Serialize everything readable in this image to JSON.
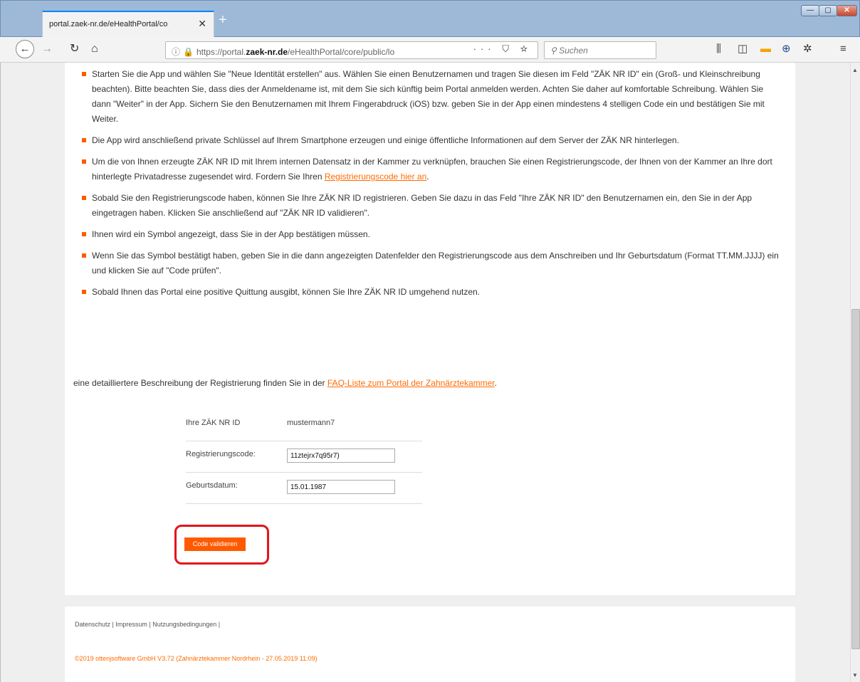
{
  "browser": {
    "tab_title": "portal.zaek-nr.de/eHealthPortal/co",
    "tab_close": "✕",
    "new_tab": "+",
    "url_prefix": "https://portal.",
    "url_domain": "zaek-nr.de",
    "url_path": "/eHealthPortal/core/public/lo",
    "url_actions": "··· ⛉ ☆",
    "search_placeholder": "Suchen",
    "icons": [
      "back-icon",
      "forward-icon",
      "reload-icon",
      "home-icon",
      "info-icon",
      "lock-icon",
      "library-icon",
      "sidebar-icon",
      "menu-icon"
    ]
  },
  "steps": [
    {
      "text": "Starten Sie die App und wählen Sie \"Neue Identität erstellen\" aus. Wählen Sie einen Benutzernamen und tragen Sie diesen im Feld \"ZÄK NR ID\" ein (Groß- und Kleinschreibung beachten). Bitte beachten Sie, dass dies der Anmeldename ist, mit dem Sie sich künftig beim Portal anmelden werden. Achten Sie daher auf komfortable Schreibung. Wählen Sie dann \"Weiter\" in der App. Sichern Sie den Benutzernamen mit Ihrem Fingerabdruck (iOS) bzw. geben Sie in der App einen mindestens 4 stelligen Code ein und bestätigen Sie mit Weiter."
    },
    {
      "text": "Die App wird anschließend private Schlüssel auf Ihrem Smartphone erzeugen und einige öffentliche Informationen auf dem Server der ZÄK NR hinterlegen."
    },
    {
      "text": "Um die von Ihnen erzeugte ZÄK NR ID mit Ihrem internen Datensatz in der Kammer zu verknüpfen, brauchen Sie einen Registrierungscode, der Ihnen von der Kammer an Ihre dort hinterlegte Privatadresse zugesendet wird. Fordern Sie Ihren ",
      "link": "Registrierungscode hier an",
      "after": "."
    },
    {
      "text": "Sobald Sie den Registrierungscode haben, können Sie Ihre ZÄK NR ID registrieren. Geben Sie dazu in das Feld \"Ihre ZÄK NR ID\" den Benutzernamen ein, den Sie in der App eingetragen haben. Klicken Sie anschließend auf \"ZÄK NR ID validieren\"."
    },
    {
      "text": "Ihnen wird ein Symbol angezeigt, dass Sie in der App bestätigen müssen."
    },
    {
      "text": "Wenn Sie das Symbol bestätigt haben, geben Sie in die dann angezeigten Datenfelder den Registrierungscode aus dem Anschreiben und Ihr Geburtsdatum (Format TT.MM.JJJJ) ein und klicken Sie auf \"Code prüfen\"."
    },
    {
      "text": "Sobald Ihnen das Portal eine positive Quittung ausgibt, können Sie Ihre ZÄK NR ID umgehend nutzen."
    }
  ],
  "intro": {
    "text": "eine detailliertere Beschreibung der Registrierung finden Sie in der ",
    "link": "FAQ-Liste zum Portal der Zahnärztekammer",
    "after": "."
  },
  "form": {
    "id_label": "Ihre ZÄK NR ID",
    "id_value": "mustermann7",
    "code_label": "Registrierungscode:",
    "code_value": "11ztejrx7q95r7)",
    "birth_label": "Geburtsdatum:",
    "birth_value": "15.01.1987",
    "submit_label": "Code validieren"
  },
  "footer": {
    "links": "Datenschutz | Impressum | Nutzungsbedingungen |",
    "copyright": "©2019 ottenjsoftware GmbH V3.72 (Zahnärztekammer Nordrhein - 27.05.2019 11:09)"
  },
  "colors": {
    "accent": "#ff5a00",
    "highlight": "#e3141b"
  }
}
